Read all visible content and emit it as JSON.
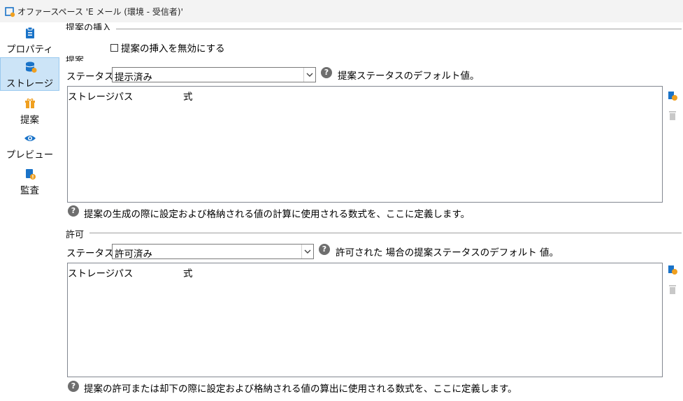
{
  "window": {
    "title": "オファースペース 'E メール (環境 - 受信者)'"
  },
  "sidebar": {
    "items": [
      {
        "label": "プロパティ",
        "icon": "clipboard-icon"
      },
      {
        "label": "ストレージ",
        "icon": "database-icon",
        "active": true
      },
      {
        "label": "提案",
        "icon": "gift-icon"
      },
      {
        "label": "プレビュー",
        "icon": "eye-icon"
      },
      {
        "label": "監査",
        "icon": "audit-icon"
      }
    ]
  },
  "insert_section": {
    "title": "提案の挿入",
    "disable_checkbox_label": "提案の挿入を無効にする",
    "checked": false
  },
  "proposal_section": {
    "title": "提案",
    "status_label": "ステータス:",
    "status_value": "提示済み",
    "status_help": "提案ステータスのデフォルト値。",
    "grid_columns": [
      "ストレージパス",
      "式"
    ],
    "footer_help": "提案の生成の際に設定および格納される値の計算に使用される数式を、ここに定義します。"
  },
  "accept_section": {
    "title": "許可",
    "status_label": "ステータス:",
    "status_value": "許可済み",
    "status_help": "許可された 場合の提案ステータスのデフォルト 値。",
    "grid_columns": [
      "ストレージパス",
      "式"
    ],
    "footer_help": "提案の許可または却下の際に設定および格納される値の算出に使用される数式を、ここに定義します。"
  },
  "colors": {
    "accent": "#1a73c8",
    "orange": "#f0a020",
    "active_bg": "#cce4f7",
    "help_gray": "#6e6e6e"
  }
}
